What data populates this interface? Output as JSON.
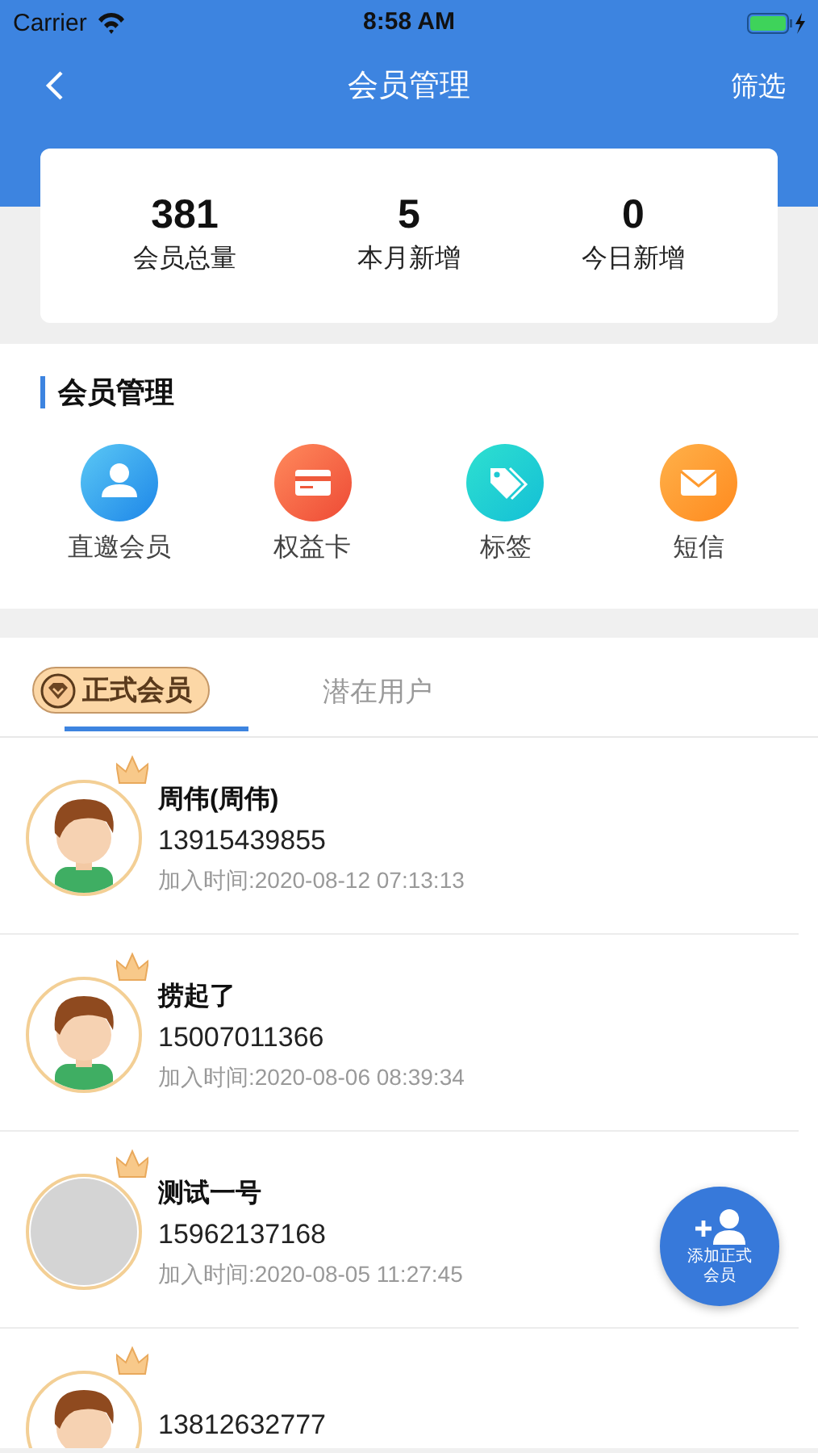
{
  "status_bar": {
    "carrier": "Carrier",
    "time": "8:58 AM"
  },
  "nav": {
    "title": "会员管理",
    "action": "筛选"
  },
  "stats": [
    {
      "value": "381",
      "label": "会员总量"
    },
    {
      "value": "5",
      "label": "本月新增"
    },
    {
      "value": "0",
      "label": "今日新增"
    }
  ],
  "section": {
    "title": "会员管理",
    "actions": [
      {
        "label": "直邀会员",
        "kind": "person"
      },
      {
        "label": "权益卡",
        "kind": "card"
      },
      {
        "label": "标签",
        "kind": "tag"
      },
      {
        "label": "短信",
        "kind": "mail"
      }
    ]
  },
  "tabs": [
    {
      "label": "正式会员",
      "selected": true
    },
    {
      "label": "潜在用户",
      "selected": false
    }
  ],
  "members": [
    {
      "name": "周伟(周伟)",
      "phone": "13915439855",
      "joined": "加入时间:2020-08-12 07:13:13",
      "kind": "cartoon"
    },
    {
      "name": "捞起了",
      "phone": "15007011366",
      "joined": "加入时间:2020-08-06 08:39:34",
      "kind": "cartoon"
    },
    {
      "name": "测试一号",
      "phone": "15962137168",
      "joined": "加入时间:2020-08-05 11:27:45",
      "kind": "blank"
    },
    {
      "phone": "13812632777",
      "kind": "cartoon"
    }
  ],
  "fab": {
    "label": "添加正式会员"
  }
}
